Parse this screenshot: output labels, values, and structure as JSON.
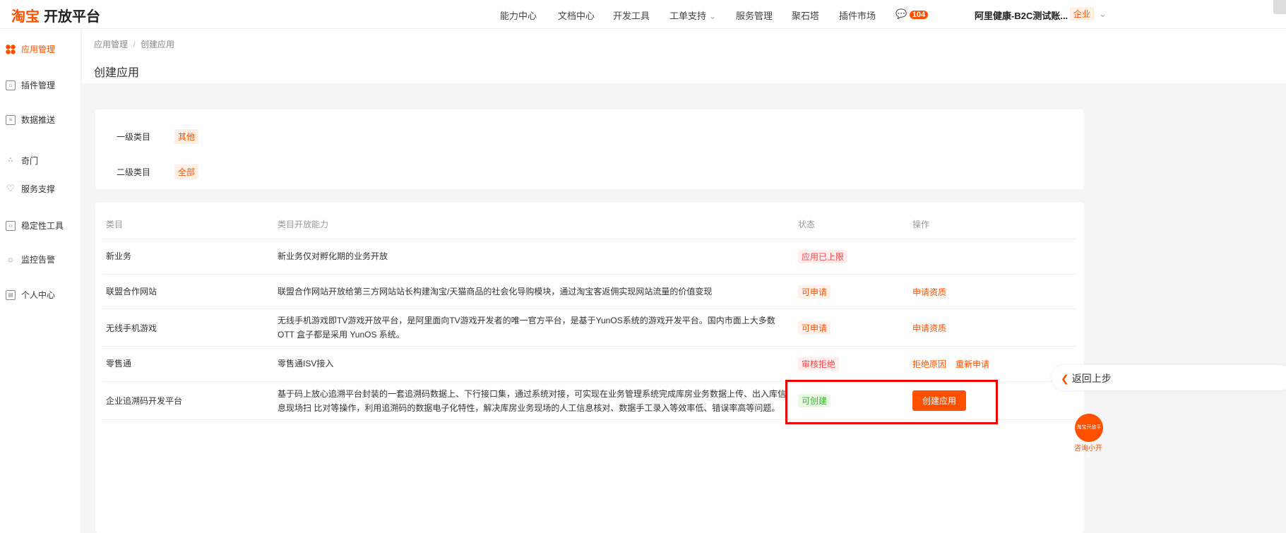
{
  "header": {
    "logo_brand": "淘宝",
    "logo_text": "开放平台",
    "nav": [
      "能力中心",
      "文档中心",
      "开发工具",
      "工单支持",
      "服务管理",
      "聚石塔",
      "插件市场"
    ],
    "message_count": "104",
    "account": "阿里健康-B2C测试账...",
    "account_tag": "企业"
  },
  "sidebar": {
    "items": [
      {
        "label": "应用管理",
        "icon": "grid-icon"
      },
      {
        "label": "插件管理",
        "icon": "plugin-icon"
      },
      {
        "label": "数据推送",
        "icon": "document-icon"
      },
      {
        "label": "奇门",
        "icon": "nodes-icon"
      },
      {
        "label": "服务支撑",
        "icon": "heart-icon"
      },
      {
        "label": "稳定性工具",
        "icon": "monitor-icon"
      },
      {
        "label": "监控告警",
        "icon": "alarm-icon"
      },
      {
        "label": "个人中心",
        "icon": "profile-icon"
      }
    ]
  },
  "breadcrumb": {
    "parent": "应用管理",
    "sep": "/",
    "current": "创建应用"
  },
  "page_title": "创建应用",
  "filters": {
    "level1_label": "一级类目",
    "level1_value": "其他",
    "level2_label": "二级类目",
    "level2_value": "全部"
  },
  "table": {
    "headers": [
      "类目",
      "类目开放能力",
      "状态",
      "操作"
    ],
    "rows": [
      {
        "category": "新业务",
        "desc": "新业务仅对孵化期的业务开放",
        "status": "应用已上限",
        "actions": []
      },
      {
        "category": "联盟合作网站",
        "desc": "联盟合作网站开放给第三方网站站长构建淘宝/天猫商品的社会化导购模块，通过淘宝客返佣实现网站流量的价值变现",
        "status": "可申请",
        "actions": [
          "申请资质"
        ]
      },
      {
        "category": "无线手机游戏",
        "desc": "无线手机游戏即TV游戏开放平台，是阿里面向TV游戏开发者的唯一官方平台，是基于YunOS系统的游戏开发平台。国内市面上大多数 OTT 盒子都是采用 YunOS 系统。",
        "status": "可申请",
        "actions": [
          "申请资质"
        ]
      },
      {
        "category": "零售通",
        "desc": "零售通ISV接入",
        "status": "审核拒绝",
        "actions": [
          "拒绝原因",
          "重新申请"
        ]
      },
      {
        "category": "企业追溯码开发平台",
        "desc": "基于码上放心追溯平台封装的一套追溯码数据上、下行接口集，通过系统对接，可实现在业务管理系统完成库房业务数据上传、出入库信息现场扫 比对等操作，利用追溯码的数据电子化特性，解决库房业务现场的人工信息核对、数据手工录入等效率低、错误率高等问题。",
        "status": "可创建",
        "actions": [
          "创建应用"
        ]
      }
    ]
  },
  "float": {
    "back_label": "返回上步",
    "consult_label": "咨询小开",
    "consult_icon_text": "淘宝开放平台"
  },
  "colors": {
    "accent": "#ff5000",
    "highlight_box": "#e00000"
  }
}
